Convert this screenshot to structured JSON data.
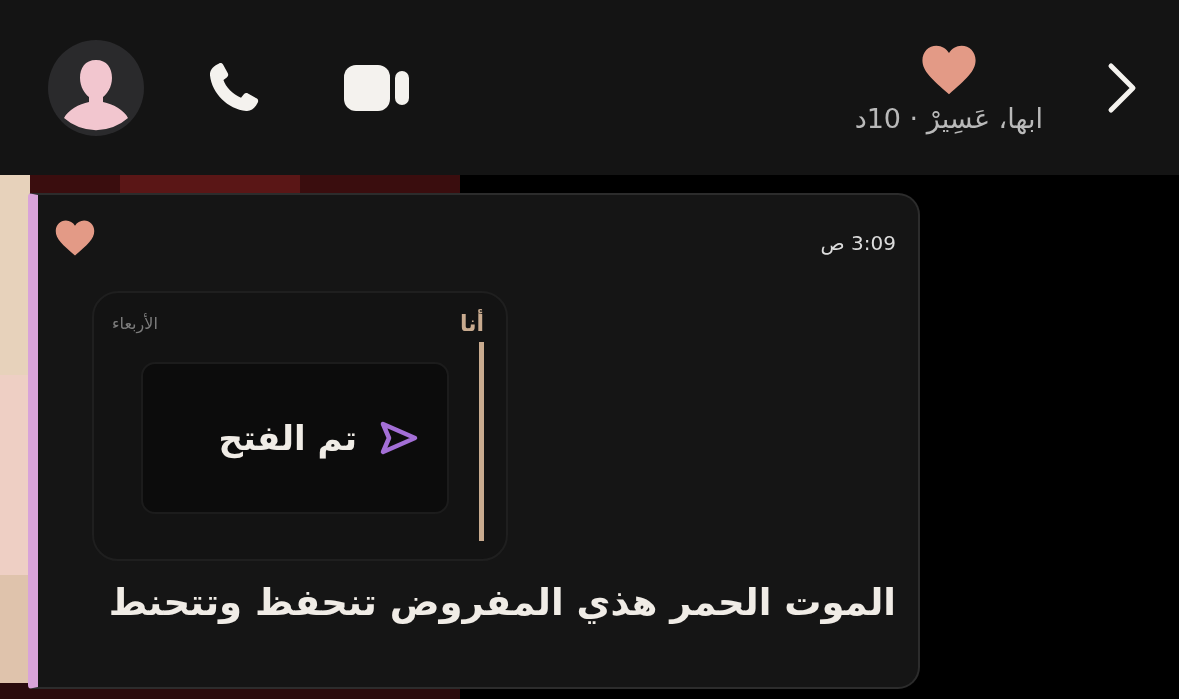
{
  "header": {
    "location": "ابها، عَسِيرْ · 10د"
  },
  "message": {
    "time": "3:09 ص",
    "quote": {
      "sender": "أنا",
      "day": "الأربعاء",
      "status": "تم الفتح"
    },
    "text": "الموت الحمر هذي المفروض تنحفظ وتتحنط"
  }
}
